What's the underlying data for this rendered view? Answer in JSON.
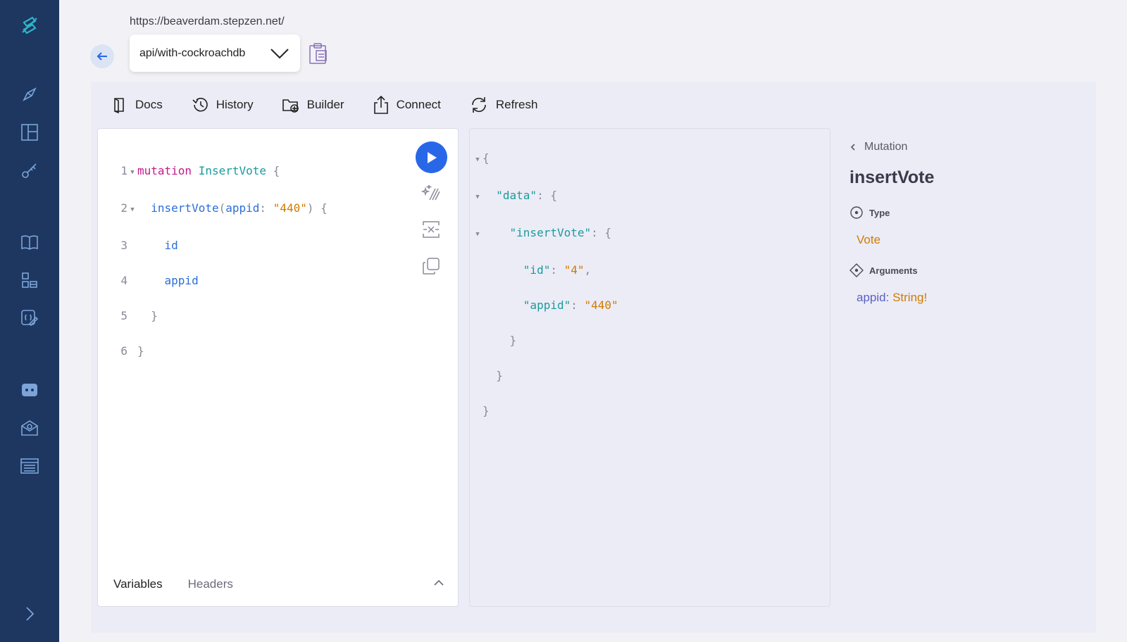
{
  "sidebar": {
    "icons": [
      "stepzen-logo-icon",
      "explorer-icon",
      "layout-icon",
      "key-icon",
      "book-icon",
      "blocks-icon",
      "schema-icon",
      "discord-icon",
      "mail-icon",
      "table-icon",
      "expand-icon"
    ]
  },
  "header": {
    "url": "https://beaverdam.stepzen.net/",
    "endpoint": "api/with-cockroachdb"
  },
  "toolbar": {
    "docs": "Docs",
    "history": "History",
    "builder": "Builder",
    "connect": "Connect",
    "refresh": "Refresh"
  },
  "editor": {
    "line_numbers": [
      "1",
      "2",
      "3",
      "4",
      "5",
      "6"
    ],
    "l1": {
      "kw": "mutation",
      "name": "InsertVote",
      "brace": "{"
    },
    "l2": {
      "field": "insertVote",
      "open": "(",
      "arg": "appid",
      "colon": ":",
      "value": "\"440\"",
      "close": ")",
      "brace": "{"
    },
    "l3": "id",
    "l4": "appid",
    "l5": "}",
    "l6": "}",
    "footer": {
      "variables": "Variables",
      "headers": "Headers"
    }
  },
  "result": {
    "l1": "{",
    "l2": {
      "key": "\"data\"",
      "rest": ": {"
    },
    "l3": {
      "key": "\"insertVote\"",
      "rest": ": {"
    },
    "l4": {
      "key": "\"id\"",
      "sep": ": ",
      "value": "\"4\"",
      "comma": ","
    },
    "l5": {
      "key": "\"appid\"",
      "sep": ": ",
      "value": "\"440\""
    },
    "l6": "}",
    "l7": "}",
    "l8": "}"
  },
  "docs": {
    "breadcrumb": "Mutation",
    "title": "insertVote",
    "type_label": "Type",
    "type_value": "Vote",
    "arguments_label": "Arguments",
    "arg_name": "appid:",
    "arg_type": "String!"
  },
  "colors": {
    "sidebar": "#1d3760",
    "accent": "#2868e8",
    "keyword": "#c4198a",
    "name": "#1a9b9c",
    "field": "#2b6ed8",
    "string": "#d07b00"
  }
}
